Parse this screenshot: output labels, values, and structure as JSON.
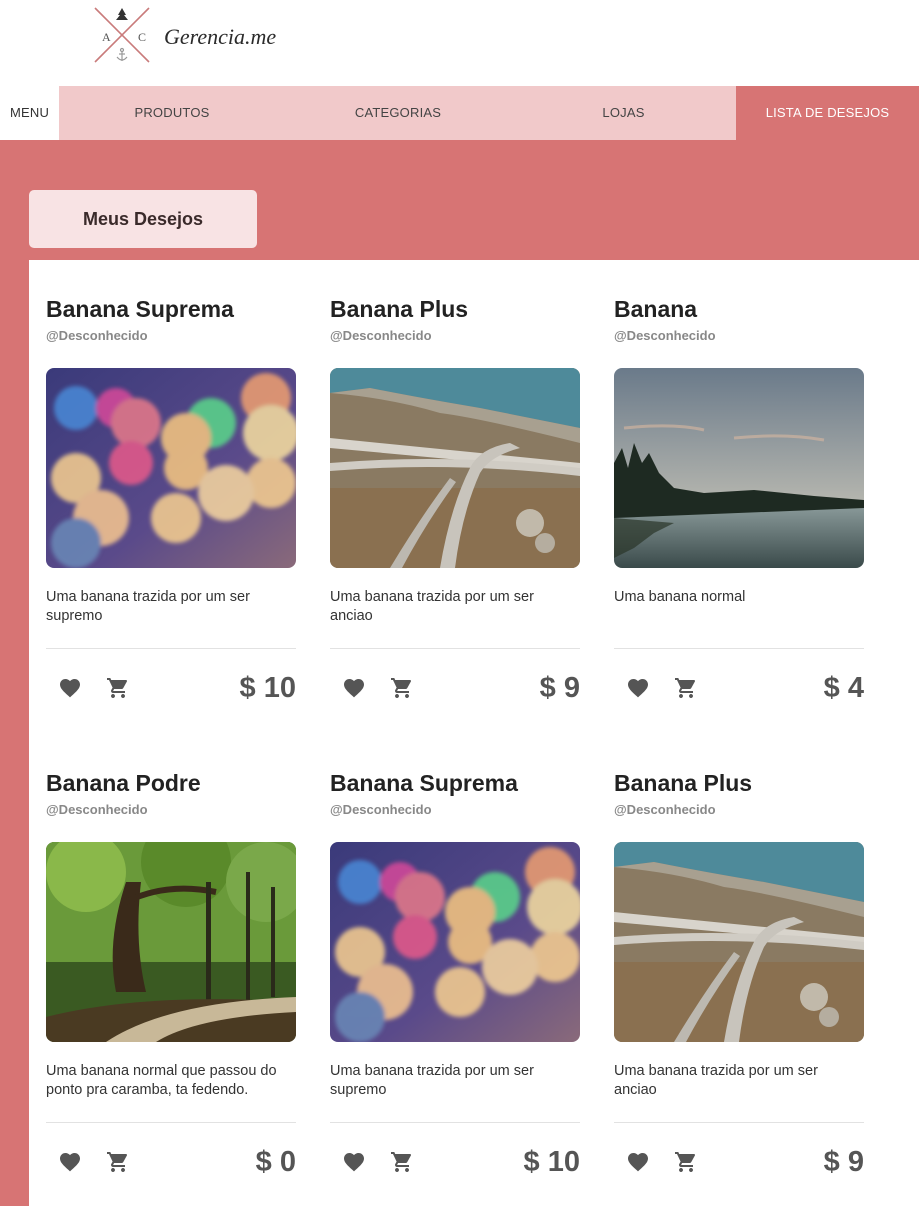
{
  "brand": {
    "name": "Gerencia.me",
    "logo_letters": [
      "A",
      "C"
    ]
  },
  "nav": {
    "menu": "MENU",
    "items": [
      "PRODUTOS",
      "CATEGORIAS",
      "LOJAS",
      "LISTA DE DESEJOS"
    ],
    "active": "LISTA DE DESEJOS"
  },
  "colors": {
    "accent": "#d77474",
    "nav_bg": "#f1c9ca",
    "tab_bg": "#f8e3e4"
  },
  "page": {
    "title": "Meus Desejos"
  },
  "products": [
    {
      "title": "Banana Suprema",
      "author": "@Desconhecido",
      "image": "bokeh-lights-photo",
      "description": "Uma banana trazida por um ser supremo",
      "price": "$ 10"
    },
    {
      "title": "Banana Plus",
      "author": "@Desconhecido",
      "image": "highway-interchange-photo",
      "description": "Uma banana trazida por um ser anciao",
      "price": "$ 9"
    },
    {
      "title": "Banana",
      "author": "@Desconhecido",
      "image": "lake-forest-photo",
      "description": "Uma banana normal",
      "price": "$ 4"
    },
    {
      "title": "Banana Podre",
      "author": "@Desconhecido",
      "image": "forest-path-photo",
      "description": "Uma banana normal que passou do ponto pra caramba, ta fedendo.",
      "price": "$ 0"
    },
    {
      "title": "Banana Suprema",
      "author": "@Desconhecido",
      "image": "bokeh-lights-photo",
      "description": "Uma banana trazida por um ser supremo",
      "price": "$ 10"
    },
    {
      "title": "Banana Plus",
      "author": "@Desconhecido",
      "image": "highway-interchange-photo",
      "description": "Uma banana trazida por um ser anciao",
      "price": "$ 9"
    }
  ],
  "icons": {
    "wishlist": "heart-icon",
    "cart": "cart-icon"
  }
}
